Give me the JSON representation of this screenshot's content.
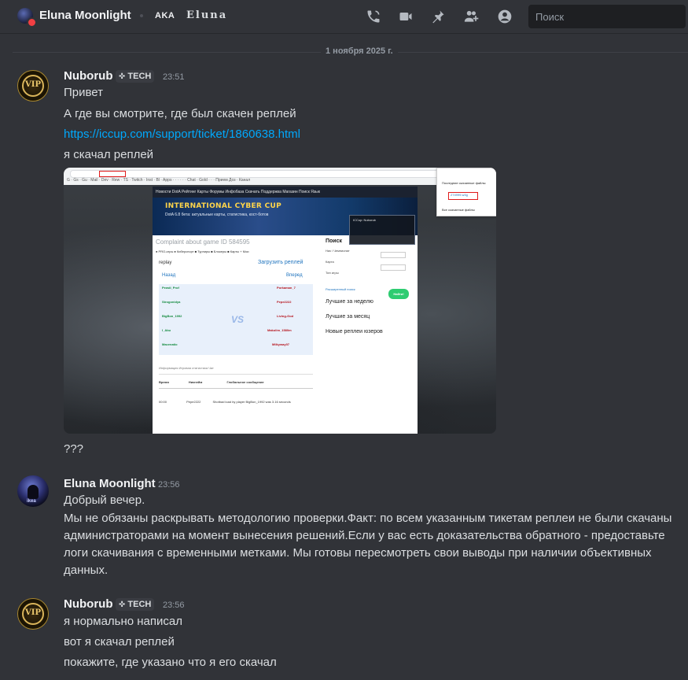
{
  "header": {
    "name": "Eluna Moonlight",
    "aka_label": "AKA",
    "nickname": "Eluna",
    "search_placeholder": "Поиск",
    "icons": [
      "call-icon",
      "video-icon",
      "pin-icon",
      "add-member-icon",
      "profile-icon"
    ]
  },
  "divider": {
    "date": "1 ноября 2025 г."
  },
  "messages": [
    {
      "author": "Nuborub",
      "tag": "TECH",
      "time": "23:51",
      "lines": [
        "Привет",
        "А где вы смотрите, где был скачен реплей",
        "https://iccup.com/support/ticket/1860638.html",
        "я скачал реплей"
      ],
      "after_image": "???"
    },
    {
      "author": "Eluna Moonlight",
      "time": "23:56",
      "greeting": "Добрый вечер.",
      "body": "Мы не обязаны раскрывать методологию проверки.Факт: по всем указанным тикетам реплеи не были скачаны администраторами на момент вынесения решений.Если у вас есть доказательства обратного - предоставьте логи скачивания с временными метками. Мы готовы пересмотреть свои выводы при наличии объективных данных."
    },
    {
      "author": "Nuborub",
      "tag": "TECH",
      "time": "23:56",
      "lines": [
        "я нормально написал",
        "вот я скачал реплей",
        "покажите, где указано что я его скачал"
      ]
    }
  ],
  "screenshot": {
    "nav": "Новости  DotA  Рейтинг  Карты  Форумы  Инфобаза  Скачать  Поддержка  Магазин  Поиск  Язык",
    "banner_title": "INTERNATIONAL CYBER CUP",
    "banner_sub": "DotA 6.8 бета: актуальные карты, статистика, кост-ботов",
    "complaint_title": "Complaint about game ID 584595",
    "replay_label": "replay",
    "download_label": "Загрузить реплей",
    "back_label": "Назад",
    "forward_label": "Вперед",
    "left_players": [
      "Pewdi_Prof",
      "Strogonidya",
      "BigBon_1992",
      "I_Abu",
      "Macenatio"
    ],
    "right_players": [
      "Porkaman_7",
      "Pepe2222",
      "Living-God",
      "Makolim_1580m",
      "Milkyway07"
    ],
    "tabs": "Информация   Игровая статистика   Чат",
    "table_headers": [
      "Время",
      "Никнейм",
      "Глобальное сообщение"
    ],
    "table_row": [
      "00:00",
      "Pepe2222",
      "Shotbad load by player BigBon_1992 was 3.16 seconds"
    ],
    "search_title": "Поиск",
    "search_fields": [
      "Ник / Чемпионат",
      "Карта",
      "Тип игры"
    ],
    "search_button": "Найти!",
    "advanced": "Расширенный поиск",
    "best_week": "Лучшие за неделю",
    "best_month": "Лучшие за месяц",
    "new_replays": "Новые реплеи юзеров",
    "downloads_title": "Последние скачанные файлы",
    "downloads_file": "274999.w3g",
    "downloads_all": "Все скачанные файлы",
    "profile_name": "ICCup: Nuborub"
  }
}
